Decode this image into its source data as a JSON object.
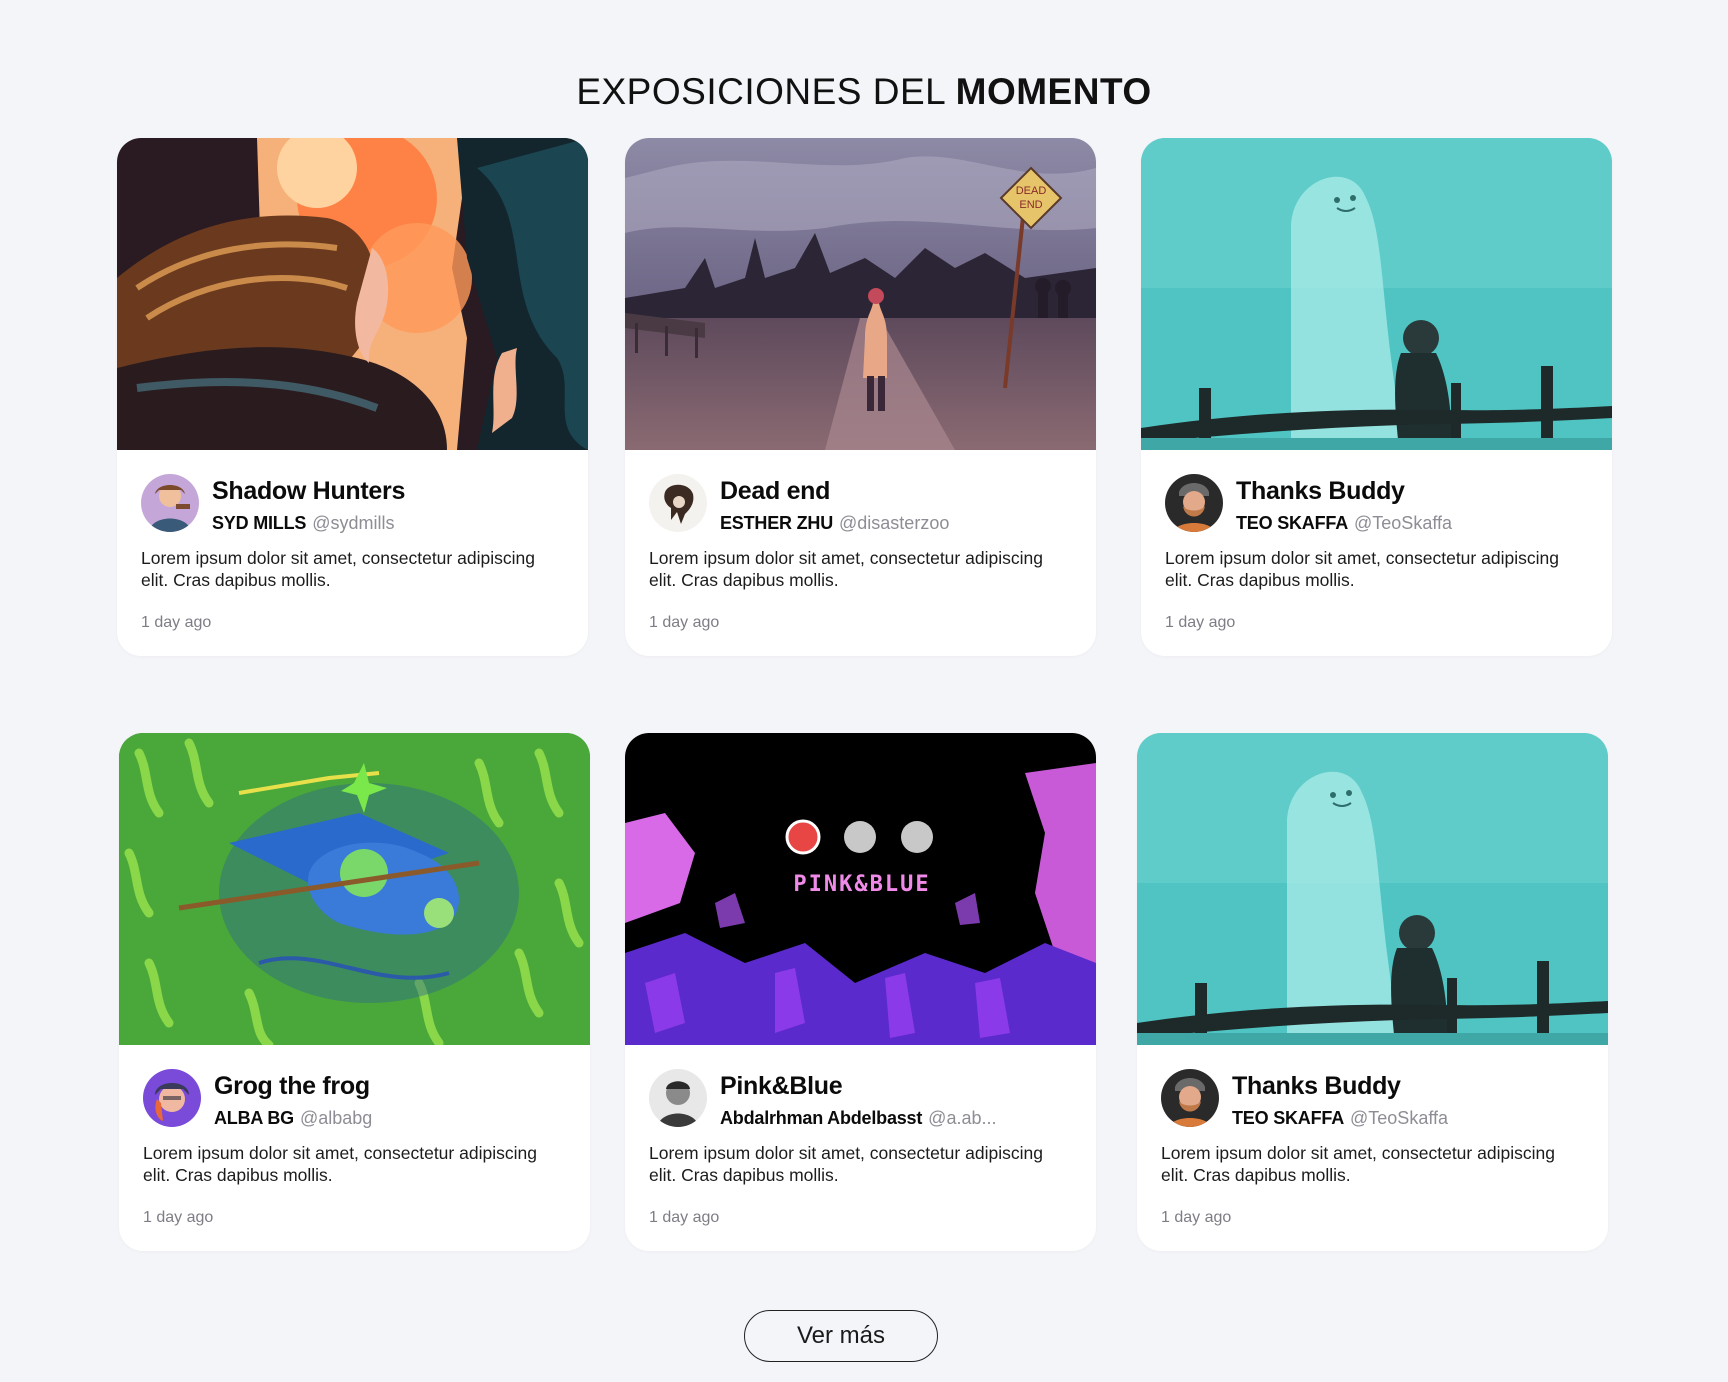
{
  "section": {
    "title_light": "EXPOSICIONES DEL ",
    "title_bold": "MOMENTO"
  },
  "cards": [
    {
      "title": "Shadow Hunters",
      "author": "SYD MILLS",
      "handle": "@sydmills",
      "description": "Lorem ipsum dolor sit amet, consectetur adipiscing elit. Cras dapibus mollis.",
      "time": "1 day ago",
      "image": "painting-woman-flames"
    },
    {
      "title": "Dead end",
      "author": "ESTHER ZHU",
      "handle": "@disasterzoo",
      "description": "Lorem ipsum dolor sit amet, consectetur adipiscing elit. Cras dapibus mollis.",
      "time": "1 day ago",
      "image": "painting-dead-end-road",
      "sign_text_1": "DEAD",
      "sign_text_2": "END"
    },
    {
      "title": "Thanks Buddy",
      "author": "TEO SKAFFA",
      "handle": "@TeoSkaffa",
      "description": "Lorem ipsum dolor sit amet, consectetur adipiscing elit. Cras dapibus mollis.",
      "time": "1 day ago",
      "image": "illustration-ghost-fence"
    },
    {
      "title": "Grog the frog",
      "author": "ALBA BG",
      "handle": "@albabg",
      "description": "Lorem ipsum dolor sit amet, consectetur adipiscing elit. Cras dapibus mollis.",
      "time": "1 day ago",
      "image": "illustration-frog-flying"
    },
    {
      "title": "Pink&Blue",
      "author": "Abdalrhman Abdelbasst",
      "handle": "@a.ab...",
      "description": "Lorem ipsum dolor sit amet, consectetur adipiscing elit. Cras dapibus mollis.",
      "time": "1 day ago",
      "image": "pixel-art-pink-blue",
      "art_text": "PINK&BLUE"
    },
    {
      "title": "Thanks Buddy",
      "author": "TEO SKAFFA",
      "handle": "@TeoSkaffa",
      "description": "Lorem ipsum dolor sit amet, consectetur adipiscing elit. Cras dapibus mollis.",
      "time": "1 day ago",
      "image": "illustration-ghost-fence"
    }
  ],
  "footer": {
    "more_label": "Ver más"
  },
  "colors": {
    "background": "#f4f5f9",
    "card": "#ffffff",
    "text": "#111111",
    "muted": "#8d8d95",
    "window_dot_red": "#e84545"
  }
}
